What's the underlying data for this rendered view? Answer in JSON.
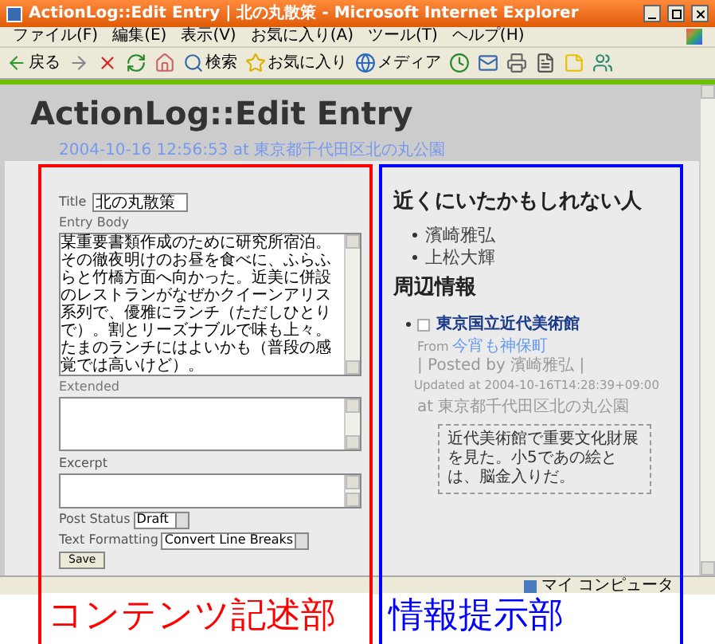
{
  "window": {
    "title": "ActionLog::Edit Entry | 北の丸散策 - Microsoft Internet Explorer"
  },
  "menu": [
    "ファイル(F)",
    "編集(E)",
    "表示(V)",
    "お気に入り(A)",
    "ツール(T)",
    "ヘルプ(H)"
  ],
  "toolbar": [
    {
      "kind": "back",
      "label": "戻る"
    },
    {
      "kind": "forward"
    },
    {
      "kind": "stop"
    },
    {
      "kind": "refresh"
    },
    {
      "kind": "home"
    },
    {
      "kind": "search",
      "label": "検索"
    },
    {
      "kind": "favorites",
      "label": "お気に入り"
    },
    {
      "kind": "media",
      "label": "メディア"
    },
    {
      "kind": "history"
    },
    {
      "kind": "mail"
    },
    {
      "kind": "print"
    },
    {
      "kind": "edit"
    },
    {
      "kind": "note"
    },
    {
      "kind": "messenger"
    }
  ],
  "page": {
    "heading": "ActionLog::Edit Entry",
    "dateline": "2004-10-16 12:56:53 at 東京都千代田区北の丸公園"
  },
  "form": {
    "title_label": "Title",
    "title_value": "北の丸散策",
    "body_label": "Entry Body",
    "body_value": "某重要書類作成のために研究所宿泊。その徹夜明けのお昼を食べに、ふらふらと竹橋方面へ向かった。近美に併設のレストランがなぜかクイーンアリス系列で、優雅にランチ（ただしひとりで）。割とリーズナブルで味も上々。たまのランチにはよいかも（普段の感覚では高いけど）。",
    "extended_label": "Extended",
    "excerpt_label": "Excerpt",
    "status_label": "Post Status",
    "status_value": "Draft",
    "format_label": "Text Formatting",
    "format_value": "Convert Line Breaks",
    "save": "Save"
  },
  "sidebar": {
    "people_heading": "近くにいたかもしれない人",
    "people": [
      "濱崎雅弘",
      "上松大輝"
    ],
    "info_heading": "周辺情報",
    "items": [
      {
        "title": "東京国立近代美術館",
        "from": "From",
        "source": "今宵も神保町",
        "posted": "| Posted by 濱崎雅弘 |",
        "updated": "Updated at 2004-10-16T14:28:39+09:00",
        "place": "at 東京都千代田区北の丸公園",
        "excerpt": "近代美術館で重要文化財展を見た。小5であの絵とは、脳金入りだ。"
      }
    ]
  },
  "status_bar": {
    "zone": "マイ コンピュータ"
  },
  "annotations": [
    {
      "label": "コンテンツ記述部",
      "color": "#ff0000"
    },
    {
      "label": "情報提示部",
      "color": "#0000ff"
    }
  ]
}
